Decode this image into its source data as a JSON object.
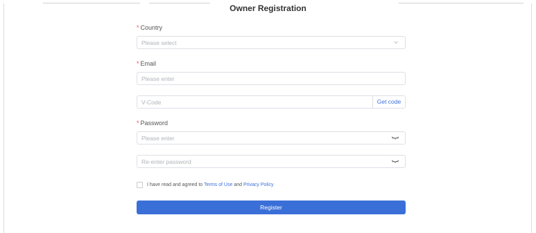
{
  "title": "Owner Registration",
  "form": {
    "country": {
      "label": "Country",
      "required_mark": "*",
      "placeholder": "Please select"
    },
    "email": {
      "label": "Email",
      "required_mark": "*",
      "placeholder": "Please enter"
    },
    "vcode": {
      "placeholder": "V-Code",
      "button_label": "Get code"
    },
    "password": {
      "label": "Password",
      "required_mark": "*",
      "placeholder": "Please enter"
    },
    "confirm_password": {
      "placeholder": "Re-enter password"
    },
    "agreement": {
      "prefix": "I have read and agreed to",
      "terms_link": "Terms of Use",
      "conjunction": "and",
      "privacy_link": "Privacy Policy"
    },
    "register_label": "Register"
  },
  "colors": {
    "primary": "#3b6fd8",
    "link": "#3a6ee0",
    "required": "#e34d4d",
    "border": "#dcdfe6"
  }
}
